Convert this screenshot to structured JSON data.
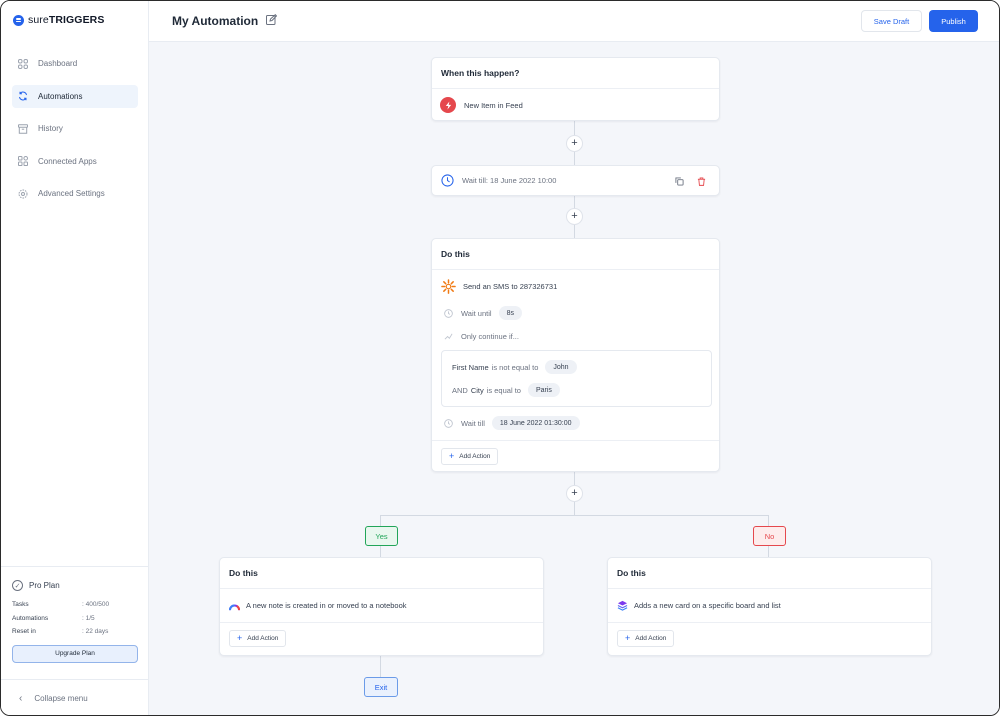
{
  "app": {
    "logo_bold": "sure",
    "logo_strong": "TRIGGERS",
    "brand_color": "#2563eb"
  },
  "sidebar": {
    "items": [
      {
        "label": "Dashboard",
        "icon": "grid-icon",
        "active": false
      },
      {
        "label": "Automations",
        "icon": "refresh-icon",
        "active": true
      },
      {
        "label": "History",
        "icon": "archive-icon",
        "active": false
      },
      {
        "label": "Connected Apps",
        "icon": "apps-icon",
        "active": false
      },
      {
        "label": "Advanced Settings",
        "icon": "gear-icon",
        "active": false
      }
    ],
    "plan": {
      "title": "Pro Plan",
      "stats": [
        {
          "key": "Tasks",
          "value": ": 400/500"
        },
        {
          "key": "Automations",
          "value": ": 1/5"
        },
        {
          "key": "Reset in",
          "value": ": 22 days"
        }
      ],
      "upgrade_label": "Upgrade Plan"
    },
    "collapse_label": "Collapse menu"
  },
  "header": {
    "title": "My Automation",
    "save_draft": "Save Draft",
    "publish": "Publish"
  },
  "flow": {
    "trigger": {
      "heading": "When this happen?",
      "item": "New Item in Feed"
    },
    "wait_step": {
      "label": "Wait till: 18 June 2022 10:00"
    },
    "action": {
      "heading": "Do this",
      "sms": "Send an SMS to 287326731",
      "wait_until_label": "Wait until",
      "wait_until_value": "8s",
      "only_continue": "Only continue if...",
      "cond1_field": "First Name",
      "cond1_op": "is not equal to",
      "cond1_value": "John",
      "cond2_prefix": "AND",
      "cond2_field": "City",
      "cond2_op": "is equal to",
      "cond2_value": "Paris",
      "wait_till_label": "Wait till",
      "wait_till_value": "18 June 2022 01:30:00",
      "add_action": "Add Action"
    },
    "yes_tag": "Yes",
    "no_tag": "No",
    "left_branch": {
      "heading": "Do this",
      "item": "A new note is created in or moved to a notebook",
      "add_action": "Add Action"
    },
    "right_branch": {
      "heading": "Do this",
      "item": "Adds a new card on a specific board and list",
      "add_action": "Add Action"
    },
    "exit": "Exit"
  },
  "colors": {
    "yes": "#22a559",
    "no": "#e5484d",
    "canvas": "#f4f6fa"
  }
}
